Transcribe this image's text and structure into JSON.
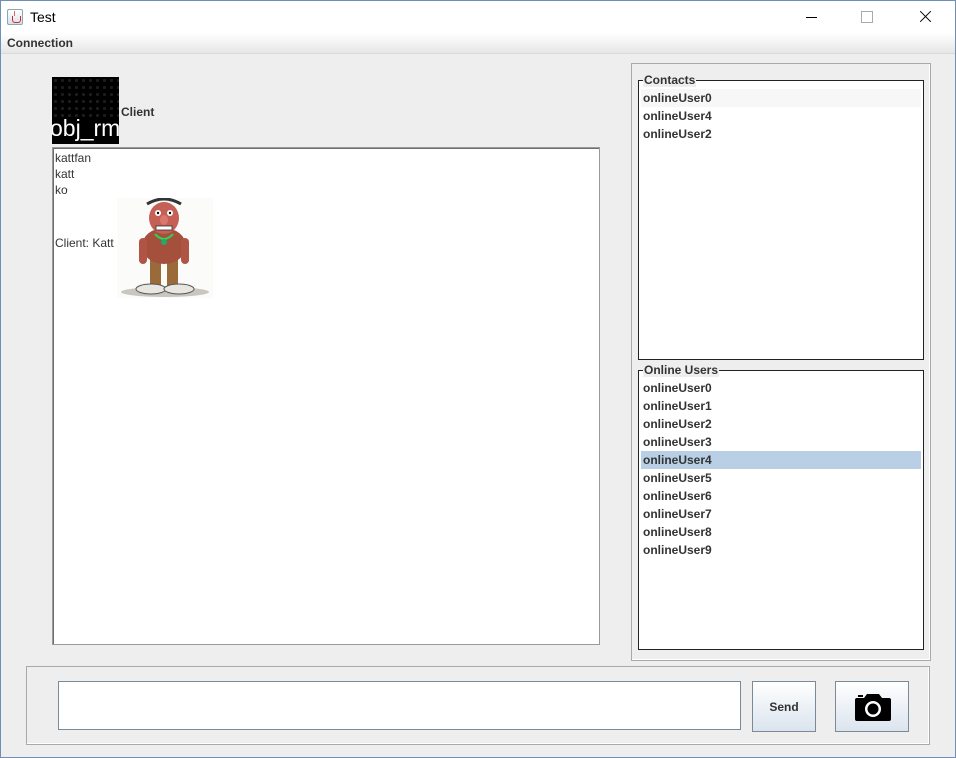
{
  "window": {
    "title": "Test",
    "icon": "java-cup-icon"
  },
  "menu": {
    "items": [
      {
        "label": "Connection"
      }
    ]
  },
  "profile": {
    "avatar_text": "obj_rm",
    "name_label": "Client"
  },
  "chat": {
    "lines": [
      "kattfan",
      "katt",
      "ko",
      "Client: Katt"
    ],
    "image": "troll-cartoon-image"
  },
  "contacts": {
    "title": "Contacts",
    "items": [
      "onlineUser0",
      "onlineUser4",
      "onlineUser2"
    ]
  },
  "online_users": {
    "title": "Online Users",
    "items": [
      "onlineUser0",
      "onlineUser1",
      "onlineUser2",
      "onlineUser3",
      "onlineUser4",
      "onlineUser5",
      "onlineUser6",
      "onlineUser7",
      "onlineUser8",
      "onlineUser9"
    ],
    "selected": "onlineUser4"
  },
  "composer": {
    "message_value": "",
    "send_label": "Send",
    "camera_icon": "camera-icon"
  },
  "colors": {
    "selection": "#b8cfe5",
    "window_border": "#6f8fb4",
    "background": "#eeeeee"
  }
}
